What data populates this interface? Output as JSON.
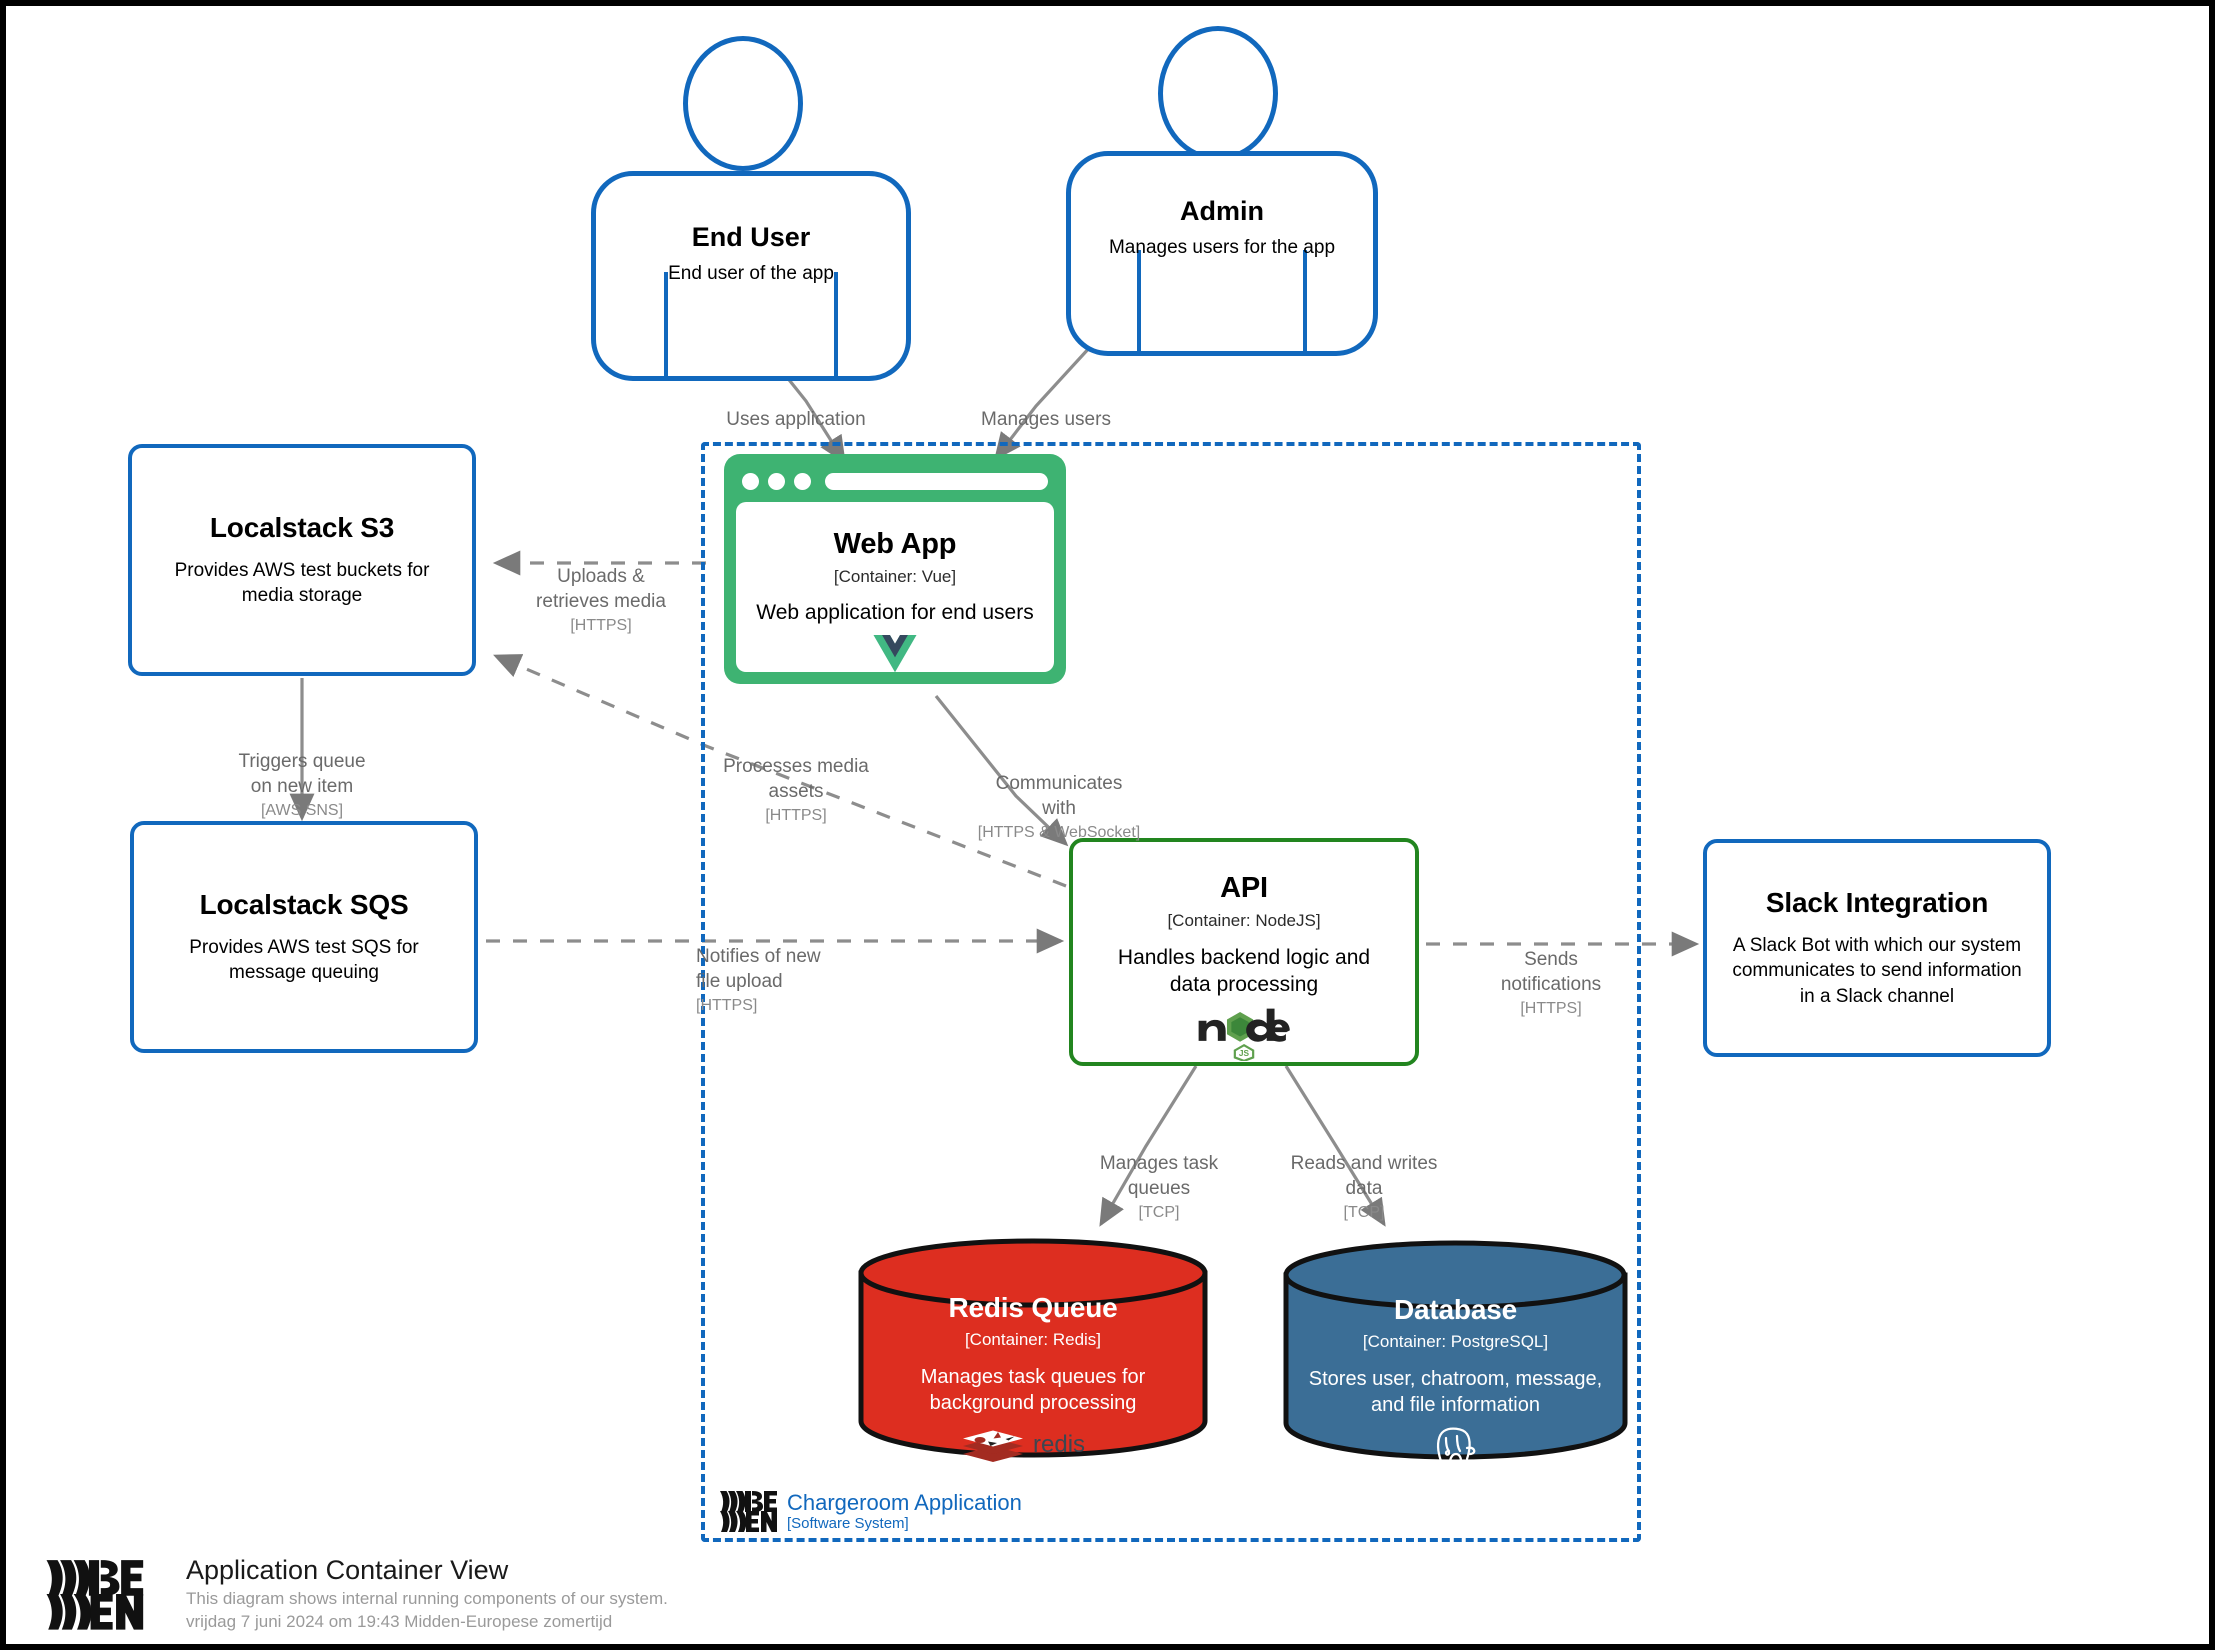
{
  "diagram": {
    "type": "C4 Container Diagram",
    "boundary": {
      "name": "Chargeroom Application",
      "type_label": "[Software System]",
      "color": "#1168BD"
    }
  },
  "people": [
    {
      "id": "end-user",
      "title": "End User",
      "description": "End user of the app",
      "color": "#1168BD"
    },
    {
      "id": "admin",
      "title": "Admin",
      "description": "Manages users for the app",
      "color": "#1168BD"
    }
  ],
  "external_systems": [
    {
      "id": "localstack-s3",
      "title": "Localstack S3",
      "description": "Provides AWS test buckets for media storage",
      "color": "#1168BD"
    },
    {
      "id": "localstack-sqs",
      "title": "Localstack SQS",
      "description": "Provides AWS test SQS for message queuing",
      "color": "#1168BD"
    },
    {
      "id": "slack-integration",
      "title": "Slack Integration",
      "description": "A Slack Bot with which our system communicates to send information in a Slack channel",
      "color": "#1168BD"
    }
  ],
  "containers": {
    "web_app": {
      "title": "Web App",
      "tech": "[Container: Vue]",
      "description": "Web application for end users",
      "color": "#3EB372",
      "logo": "vue-logo"
    },
    "api": {
      "title": "API",
      "tech": "[Container: NodeJS]",
      "description": "Handles backend logic and data processing",
      "color": "#22851F",
      "logo": "nodejs-logo"
    },
    "redis_queue": {
      "title": "Redis Queue",
      "tech": "[Container: Redis]",
      "description": "Manages task queues for background processing",
      "color": "#DD2E20",
      "logo": "redis-logo"
    },
    "database": {
      "title": "Database",
      "tech": "[Container: PostgreSQL]",
      "description": "Stores user, chatroom, message, and file information",
      "color": "#3B6E96",
      "logo": "postgresql-logo"
    }
  },
  "relationships": [
    {
      "id": "uses-application",
      "label": "Uses application",
      "protocol": "",
      "from": "end-user",
      "to": "web-app"
    },
    {
      "id": "manages-users",
      "label": "Manages users",
      "protocol": "",
      "from": "admin",
      "to": "web-app"
    },
    {
      "id": "uploads-retrieves-media",
      "label": "Uploads &\nretrieves media",
      "protocol": "[HTTPS]",
      "from": "web-app",
      "to": "localstack-s3"
    },
    {
      "id": "triggers-queue",
      "label": "Triggers queue\non new item",
      "protocol": "[AWS SNS]",
      "from": "localstack-s3",
      "to": "localstack-sqs"
    },
    {
      "id": "processes-media-assets",
      "label": "Processes media\nassets",
      "protocol": "[HTTPS]",
      "from": "api",
      "to": "localstack-s3"
    },
    {
      "id": "communicates-with",
      "label": "Communicates\nwith",
      "protocol": "[HTTPS & WebSocket]",
      "from": "web-app",
      "to": "api"
    },
    {
      "id": "notifies-of-new-file-upload",
      "label": "Notifies of new\nfile upload",
      "protocol": "[HTTPS]",
      "from": "localstack-sqs",
      "to": "api"
    },
    {
      "id": "sends-notifications",
      "label": "Sends\nnotifications",
      "protocol": "[HTTPS]",
      "from": "api",
      "to": "slack-integration"
    },
    {
      "id": "manages-task-queues",
      "label": "Manages task\nqueues",
      "protocol": "[TCP]",
      "from": "api",
      "to": "redis-queue"
    },
    {
      "id": "reads-and-writes-data",
      "label": "Reads and writes\ndata",
      "protocol": "[TCP]",
      "from": "api",
      "to": "database"
    }
  ],
  "footer": {
    "title": "Application Container View",
    "description": "This diagram shows internal running components of our system.",
    "timestamp": "vrijdag 7 juni 2024 om 19:43 Midden-Europese zomertijd",
    "logo": "wisemen-logo"
  }
}
